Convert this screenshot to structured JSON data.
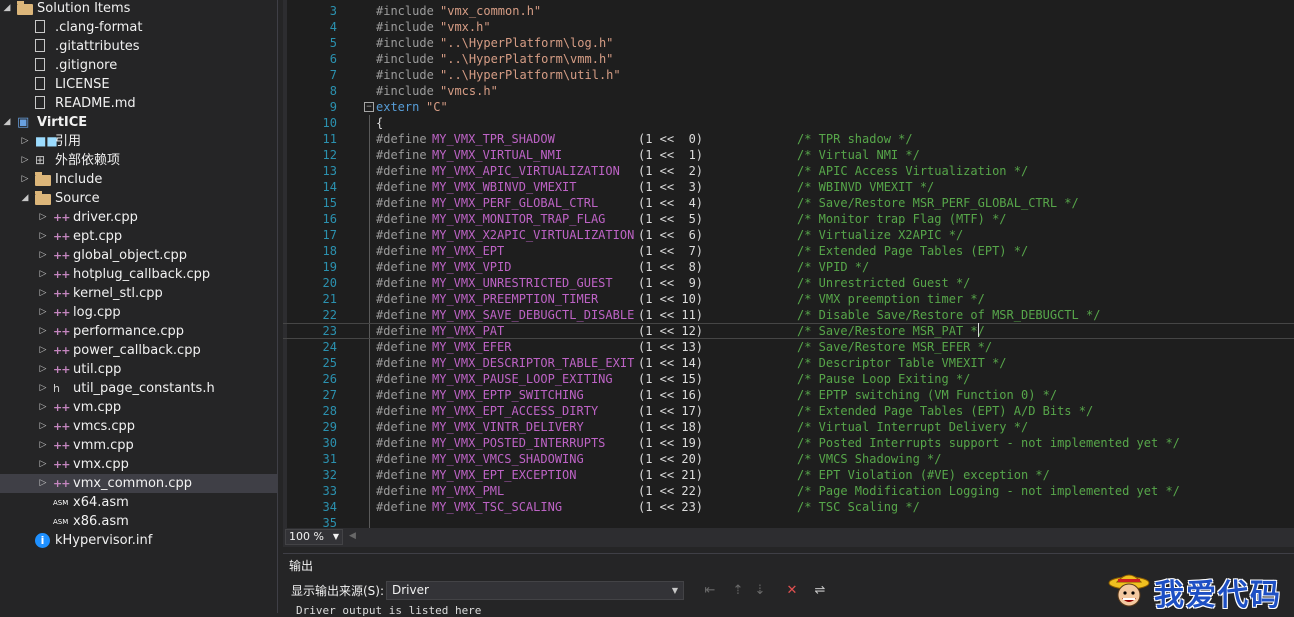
{
  "solution_explorer": {
    "rows": [
      {
        "label": "Solution Items",
        "icon": "solution-folder-icon",
        "arrow": "open"
      },
      {
        "label": ".clang-format",
        "icon": "file-icon"
      },
      {
        "label": ".gitattributes",
        "icon": "file-icon"
      },
      {
        "label": ".gitignore",
        "icon": "file-icon"
      },
      {
        "label": "LICENSE",
        "icon": "file-icon"
      },
      {
        "label": "README.md",
        "icon": "file-icon"
      },
      {
        "label": "VirtICE",
        "icon": "project-icon",
        "arrow": "open",
        "bold": true
      },
      {
        "label": "引用",
        "icon": "references-icon",
        "arrow": "closed"
      },
      {
        "label": "外部依赖项",
        "icon": "external-dependencies-icon",
        "arrow": "closed"
      },
      {
        "label": "Include",
        "icon": "folder-icon",
        "arrow": "closed"
      },
      {
        "label": "Source",
        "icon": "folder-icon",
        "arrow": "open"
      },
      {
        "label": "driver.cpp",
        "icon": "cpp-file-icon",
        "arrow": "closed"
      },
      {
        "label": "ept.cpp",
        "icon": "cpp-file-icon",
        "arrow": "closed"
      },
      {
        "label": "global_object.cpp",
        "icon": "cpp-file-icon",
        "arrow": "closed"
      },
      {
        "label": "hotplug_callback.cpp",
        "icon": "cpp-file-icon",
        "arrow": "closed"
      },
      {
        "label": "kernel_stl.cpp",
        "icon": "cpp-file-icon",
        "arrow": "closed"
      },
      {
        "label": "log.cpp",
        "icon": "cpp-file-icon",
        "arrow": "closed"
      },
      {
        "label": "performance.cpp",
        "icon": "cpp-file-icon",
        "arrow": "closed"
      },
      {
        "label": "power_callback.cpp",
        "icon": "cpp-file-icon",
        "arrow": "closed"
      },
      {
        "label": "util.cpp",
        "icon": "cpp-file-icon",
        "arrow": "closed"
      },
      {
        "label": "util_page_constants.h",
        "icon": "header-file-icon",
        "arrow": "closed"
      },
      {
        "label": "vm.cpp",
        "icon": "cpp-file-icon",
        "arrow": "closed"
      },
      {
        "label": "vmcs.cpp",
        "icon": "cpp-file-icon",
        "arrow": "closed"
      },
      {
        "label": "vmm.cpp",
        "icon": "cpp-file-icon",
        "arrow": "closed"
      },
      {
        "label": "vmx.cpp",
        "icon": "cpp-file-icon",
        "arrow": "closed"
      },
      {
        "label": "vmx_common.cpp",
        "icon": "cpp-file-icon",
        "arrow": "closed",
        "selected": true
      },
      {
        "label": "x64.asm",
        "icon": "asm-file-icon"
      },
      {
        "label": "x86.asm",
        "icon": "asm-file-icon"
      },
      {
        "label": "kHypervisor.inf",
        "icon": "info-file-icon"
      }
    ]
  },
  "editor": {
    "lines": [
      {
        "n": "3",
        "kind": "include",
        "text": "\"vmx_common.h\""
      },
      {
        "n": "4",
        "kind": "include",
        "text": "\"vmx.h\""
      },
      {
        "n": "5",
        "kind": "include",
        "text": "\"..\\HyperPlatform\\log.h\""
      },
      {
        "n": "6",
        "kind": "include",
        "text": "\"..\\HyperPlatform\\vmm.h\""
      },
      {
        "n": "7",
        "kind": "include",
        "text": "\"..\\HyperPlatform\\util.h\""
      },
      {
        "n": "8",
        "kind": "include",
        "text": "\"vmcs.h\""
      },
      {
        "n": "9",
        "kind": "extern",
        "text": "\"C\""
      },
      {
        "n": "10",
        "kind": "brace",
        "text": "{"
      },
      {
        "n": "11",
        "kind": "define",
        "macro": "MY_VMX_TPR_SHADOW",
        "value": "(1 <<  0)",
        "comment": "/* TPR shadow */"
      },
      {
        "n": "12",
        "kind": "define",
        "macro": "MY_VMX_VIRTUAL_NMI",
        "value": "(1 <<  1)",
        "comment": "/* Virtual NMI */"
      },
      {
        "n": "13",
        "kind": "define",
        "macro": "MY_VMX_APIC_VIRTUALIZATION",
        "value": "(1 <<  2)",
        "comment": "/* APIC Access Virtualization */"
      },
      {
        "n": "14",
        "kind": "define",
        "macro": "MY_VMX_WBINVD_VMEXIT",
        "value": "(1 <<  3)",
        "comment": "/* WBINVD VMEXIT */"
      },
      {
        "n": "15",
        "kind": "define",
        "macro": "MY_VMX_PERF_GLOBAL_CTRL",
        "value": "(1 <<  4)",
        "comment": "/* Save/Restore MSR_PERF_GLOBAL_CTRL */"
      },
      {
        "n": "16",
        "kind": "define",
        "macro": "MY_VMX_MONITOR_TRAP_FLAG",
        "value": "(1 <<  5)",
        "comment": "/* Monitor trap Flag (MTF) */"
      },
      {
        "n": "17",
        "kind": "define",
        "macro": "MY_VMX_X2APIC_VIRTUALIZATION",
        "value": "(1 <<  6)",
        "comment": "/* Virtualize X2APIC */"
      },
      {
        "n": "18",
        "kind": "define",
        "macro": "MY_VMX_EPT",
        "value": "(1 <<  7)",
        "comment": "/* Extended Page Tables (EPT) */"
      },
      {
        "n": "19",
        "kind": "define",
        "macro": "MY_VMX_VPID",
        "value": "(1 <<  8)",
        "comment": "/* VPID */"
      },
      {
        "n": "20",
        "kind": "define",
        "macro": "MY_VMX_UNRESTRICTED_GUEST",
        "value": "(1 <<  9)",
        "comment": "/* Unrestricted Guest */"
      },
      {
        "n": "21",
        "kind": "define",
        "macro": "MY_VMX_PREEMPTION_TIMER",
        "value": "(1 << 10)",
        "comment": "/* VMX preemption timer */"
      },
      {
        "n": "22",
        "kind": "define",
        "macro": "MY_VMX_SAVE_DEBUGCTL_DISABLE",
        "value": "(1 << 11)",
        "comment": "/* Disable Save/Restore of MSR_DEBUGCTL */"
      },
      {
        "n": "23",
        "kind": "define",
        "macro": "MY_VMX_PAT",
        "value": "(1 << 12)",
        "comment": "/* Save/Restore MSR_PAT */",
        "current": true
      },
      {
        "n": "24",
        "kind": "define",
        "macro": "MY_VMX_EFER",
        "value": "(1 << 13)",
        "comment": "/* Save/Restore MSR_EFER */"
      },
      {
        "n": "25",
        "kind": "define",
        "macro": "MY_VMX_DESCRIPTOR_TABLE_EXIT",
        "value": "(1 << 14)",
        "comment": "/* Descriptor Table VMEXIT */"
      },
      {
        "n": "26",
        "kind": "define",
        "macro": "MY_VMX_PAUSE_LOOP_EXITING",
        "value": "(1 << 15)",
        "comment": "/* Pause Loop Exiting */"
      },
      {
        "n": "27",
        "kind": "define",
        "macro": "MY_VMX_EPTP_SWITCHING",
        "value": "(1 << 16)",
        "comment": "/* EPTP switching (VM Function 0) */"
      },
      {
        "n": "28",
        "kind": "define",
        "macro": "MY_VMX_EPT_ACCESS_DIRTY",
        "value": "(1 << 17)",
        "comment": "/* Extended Page Tables (EPT) A/D Bits */"
      },
      {
        "n": "29",
        "kind": "define",
        "macro": "MY_VMX_VINTR_DELIVERY",
        "value": "(1 << 18)",
        "comment": "/* Virtual Interrupt Delivery */"
      },
      {
        "n": "30",
        "kind": "define",
        "macro": "MY_VMX_POSTED_INTERRUPTS",
        "value": "(1 << 19)",
        "comment": "/* Posted Interrupts support - not implemented yet */"
      },
      {
        "n": "31",
        "kind": "define",
        "macro": "MY_VMX_VMCS_SHADOWING",
        "value": "(1 << 20)",
        "comment": "/* VMCS Shadowing */"
      },
      {
        "n": "32",
        "kind": "define",
        "macro": "MY_VMX_EPT_EXCEPTION",
        "value": "(1 << 21)",
        "comment": "/* EPT Violation (#VE) exception */"
      },
      {
        "n": "33",
        "kind": "define",
        "macro": "MY_VMX_PML",
        "value": "(1 << 22)",
        "comment": "/* Page Modification Logging - not implemented yet */"
      },
      {
        "n": "34",
        "kind": "define",
        "macro": "MY_VMX_TSC_SCALING",
        "value": "(1 << 23)",
        "comment": "/* TSC Scaling */"
      },
      {
        "n": "35",
        "kind": "empty"
      }
    ],
    "keywords": {
      "include": "#include",
      "define": "#define",
      "extern": "extern"
    }
  },
  "zoom": {
    "value": "100 %"
  },
  "output": {
    "title": "输出",
    "source_label": "显示输出来源(S):",
    "source_value": "Driver",
    "text": "Driver output is listed here"
  },
  "watermark": {
    "text": "我爱代码"
  },
  "colors": {
    "background": "#1e1e1e",
    "line_number": "#2b91af",
    "macro": "#bd63c5",
    "comment": "#57a64a",
    "string": "#d69d85",
    "keyword": "#569cd6"
  }
}
